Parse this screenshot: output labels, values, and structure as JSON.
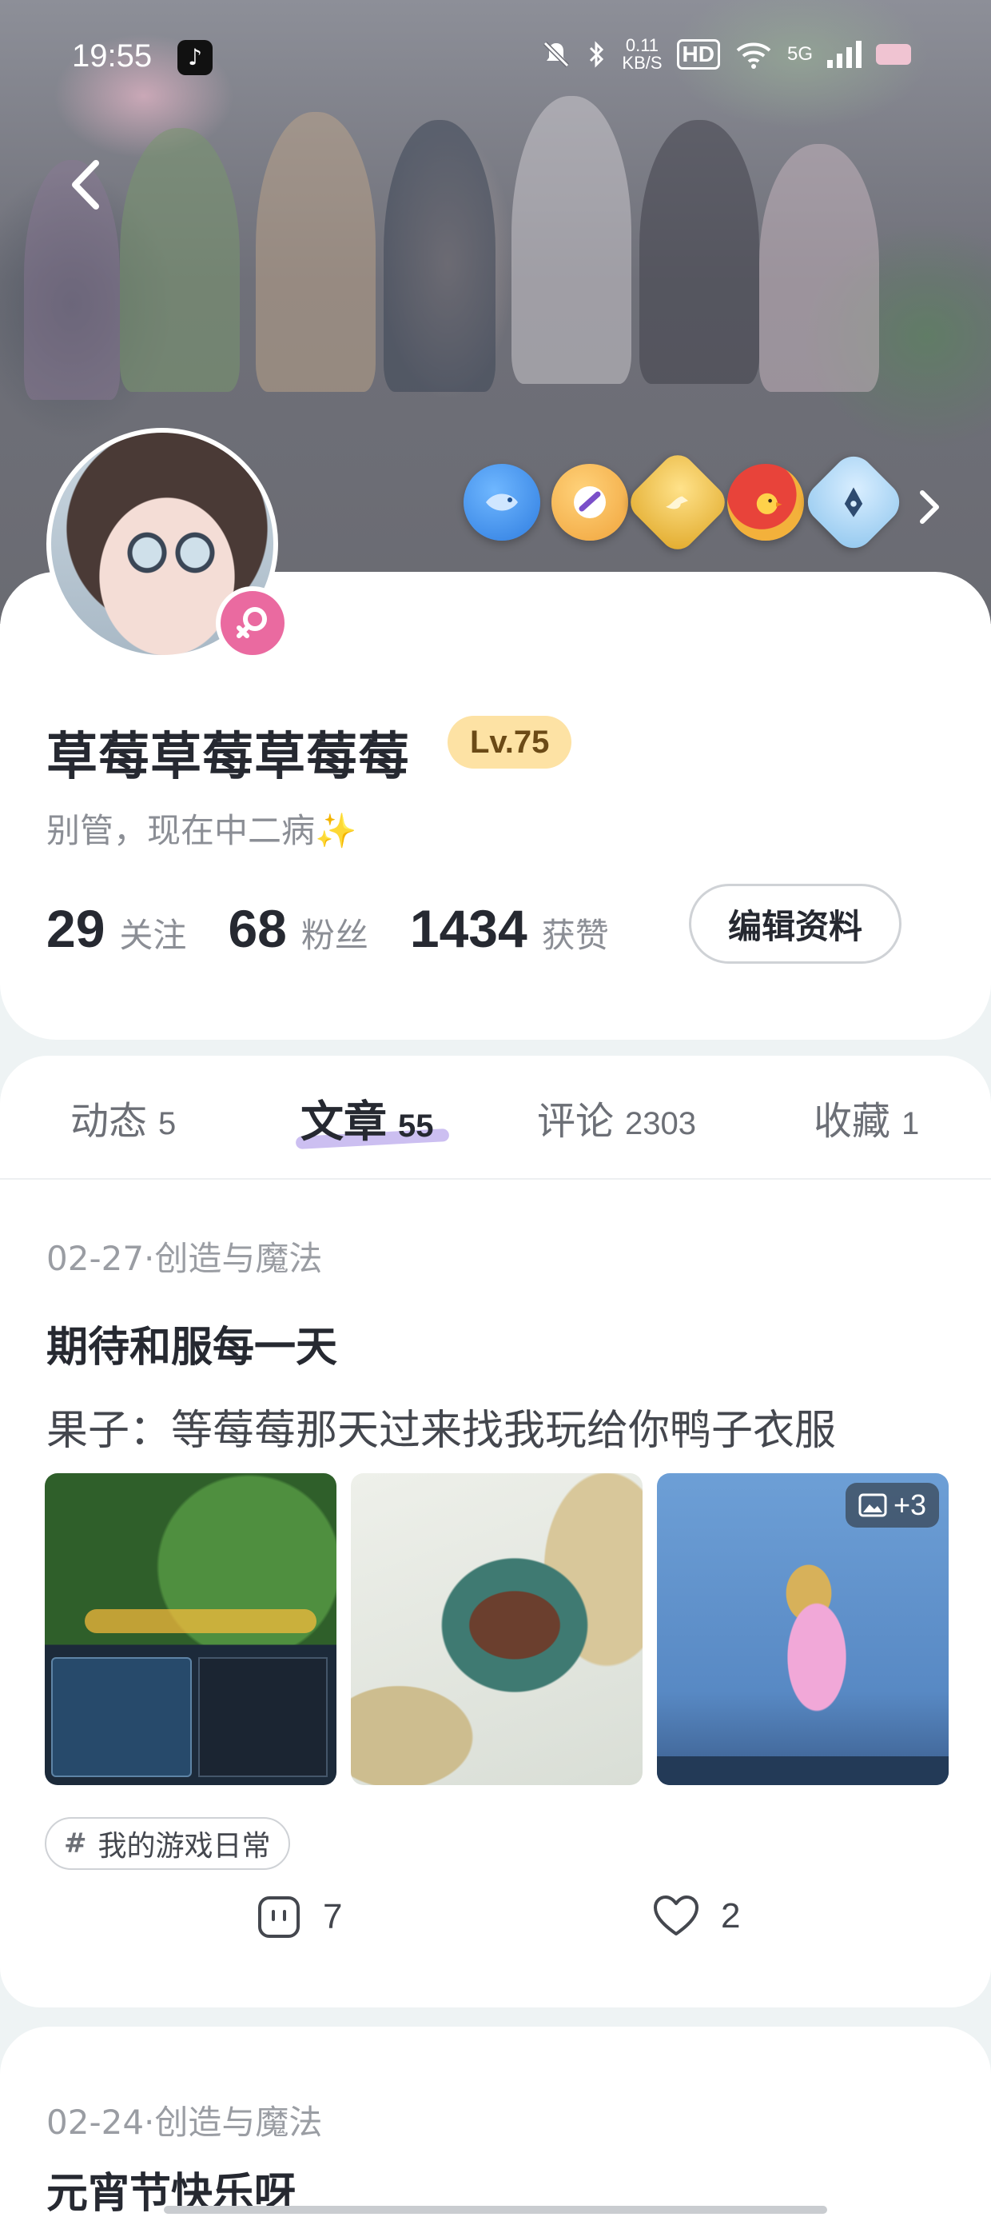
{
  "status_bar": {
    "time": "19:55",
    "app_icon": "tiktok-icon",
    "net_speed_value": "0.11",
    "net_speed_unit": "KB/S",
    "hd_label": "HD",
    "network_label": "5G",
    "icons": [
      "mute-bell-icon",
      "bluetooth-icon",
      "wifi-icon",
      "signal-icon",
      "battery-icon"
    ]
  },
  "header": {
    "back_icon": "chevron-left-icon",
    "badge_icons": [
      "fish-badge-icon",
      "brush-badge-icon",
      "gold-bird-badge-icon",
      "red-chick-badge-icon",
      "pen-nib-badge-icon"
    ],
    "badge_colors": [
      "#2f7de0",
      "#f0a43c",
      "#f3c244",
      "#e98a2a",
      "#8fc6ee"
    ],
    "more_badges_icon": "chevron-right-icon"
  },
  "profile": {
    "avatar": "avatar-image",
    "gender_icon": "female-icon",
    "gender_color": "#ea6aa0",
    "username": "草莓草莓草莓莓",
    "level": "Lv.75",
    "bio": "别管，现在中二病✨",
    "stats": [
      {
        "value": "29",
        "label": "关注"
      },
      {
        "value": "68",
        "label": "粉丝"
      },
      {
        "value": "1434",
        "label": "获赞"
      }
    ],
    "edit_button": "编辑资料"
  },
  "tabs": [
    {
      "label": "动态",
      "count": "5"
    },
    {
      "label": "文章",
      "count": "55"
    },
    {
      "label": "评论",
      "count": "2303"
    },
    {
      "label": "收藏",
      "count": "1"
    }
  ],
  "active_tab": "文章",
  "posts": [
    {
      "meta": "02-27·创造与魔法",
      "title": "期待和服每一天",
      "excerpt": "果子：等莓莓那天过来找我玩给你鸭子衣服",
      "more_images": "+3",
      "topic": "我的游戏日常",
      "comments": "7",
      "likes": "2"
    },
    {
      "meta": "02-24·创造与魔法",
      "title": "元宵节快乐呀"
    }
  ]
}
